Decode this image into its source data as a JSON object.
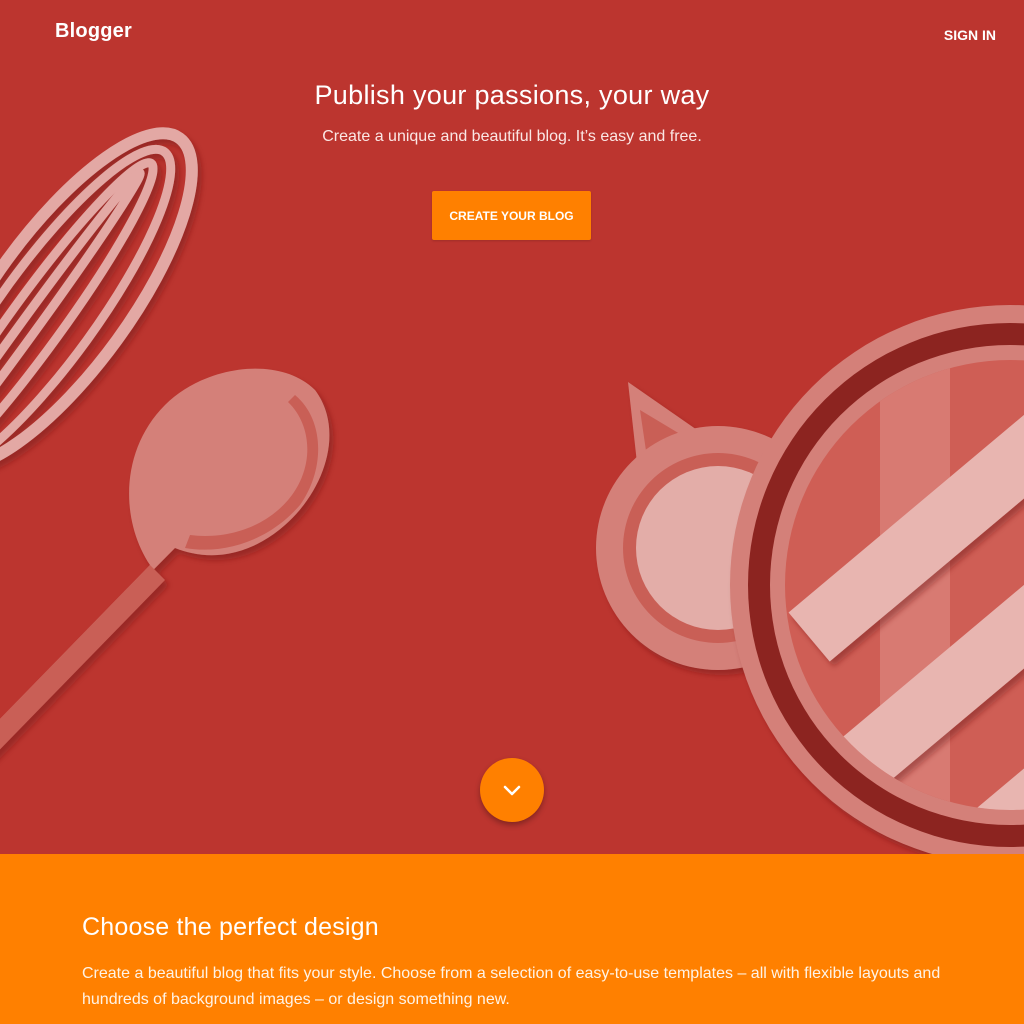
{
  "header": {
    "logo_text": "Blogger",
    "signin_label": "SIGN IN"
  },
  "hero": {
    "headline": "Publish your passions, your way",
    "subheadline": "Create a unique and beautiful blog. It’s easy and free.",
    "cta_label": "CREATE YOUR BLOG",
    "scroll_icon": "chevron-down-icon"
  },
  "design_section": {
    "title": "Choose the perfect design",
    "body": "Create a beautiful blog that fits your style. Choose from a selection of easy-to-use templates – all with flexible layouts and hundreds of background images – or design something new."
  },
  "colors": {
    "hero_background": "#bc352f",
    "accent_orange": "#ff8000",
    "text_white": "#ffffff"
  }
}
